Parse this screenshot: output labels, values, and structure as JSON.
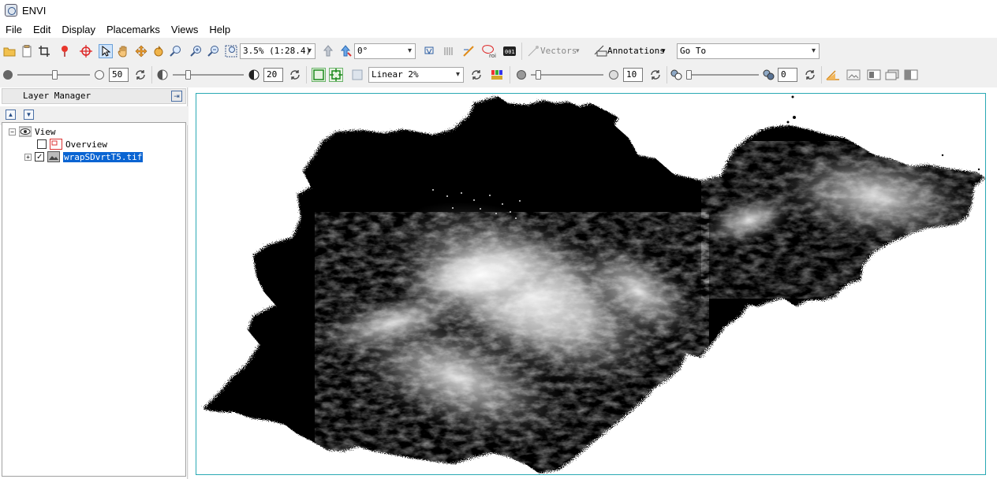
{
  "app": {
    "title": "ENVI"
  },
  "menu": [
    "File",
    "Edit",
    "Display",
    "Placemarks",
    "Views",
    "Help"
  ],
  "toolbar1": {
    "zoom_value": "3.5% (1:28.4)",
    "rotation_value": "0°",
    "vectors_label": "Vectors",
    "annotations_label": "Annotations",
    "goto_placeholder": "Go To"
  },
  "toolbar2": {
    "brightness_value": "50",
    "contrast_value": "20",
    "stretch_value": "Linear 2%",
    "sharpen_value": "10",
    "transparency_value": "0"
  },
  "layer_manager": {
    "title": "Layer Manager",
    "root": "View",
    "items": [
      {
        "label": "Overview",
        "checked": false
      },
      {
        "label": "wrapSDvrtT5.tif",
        "checked": true,
        "selected": true
      }
    ]
  },
  "colors": {
    "view_border": "#2aa9b4",
    "selection": "#0a64d2"
  }
}
